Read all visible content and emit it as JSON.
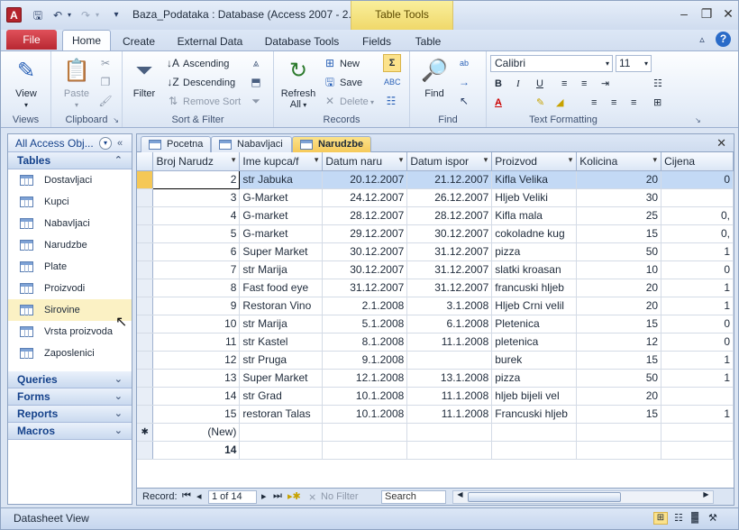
{
  "window": {
    "title": "Baza_Podataka : Database (Access 2007 - 2...",
    "context_tab": "Table Tools",
    "app_icon": "A"
  },
  "ribbon_tabs": [
    "File",
    "Home",
    "Create",
    "External Data",
    "Database Tools",
    "Fields",
    "Table"
  ],
  "ribbon": {
    "views": {
      "view_label": "View",
      "group": "Views"
    },
    "clipboard": {
      "paste_label": "Paste",
      "group": "Clipboard"
    },
    "sort_filter": {
      "filter_label": "Filter",
      "ascending": "Ascending",
      "descending": "Descending",
      "remove_sort": "Remove Sort",
      "group": "Sort & Filter"
    },
    "records": {
      "refresh_label": "Refresh",
      "refresh_all": "All",
      "new": "New",
      "save": "Save",
      "delete": "Delete",
      "group": "Records"
    },
    "find": {
      "find_label": "Find",
      "group": "Find"
    },
    "text_formatting": {
      "font": "Calibri",
      "size": "11",
      "group": "Text Formatting"
    }
  },
  "nav": {
    "header": "All Access Obj...",
    "sections": {
      "tables": "Tables",
      "queries": "Queries",
      "forms": "Forms",
      "reports": "Reports",
      "macros": "Macros"
    },
    "tables": [
      "Dostavljaci",
      "Kupci",
      "Nabavljaci",
      "Narudzbe",
      "Plate",
      "Proizvodi",
      "Sirovine",
      "Vrsta proizvoda",
      "Zaposlenici"
    ],
    "selected_index": 6
  },
  "doc_tabs": [
    "Pocetna",
    "Nabavljaci",
    "Narudzbe"
  ],
  "active_doc_tab": 2,
  "grid": {
    "columns": [
      "Broj Narudz",
      "Ime kupca/f",
      "Datum naru",
      "Datum ispor",
      "Proizvod",
      "Kolicina",
      "Cijena"
    ],
    "rows": [
      [
        "2",
        "str Jabuka",
        "20.12.2007",
        "21.12.2007",
        "Kifla Velika",
        "20",
        "0"
      ],
      [
        "3",
        "G-Market",
        "24.12.2007",
        "26.12.2007",
        "Hljeb Veliki",
        "30",
        ""
      ],
      [
        "4",
        "G-market",
        "28.12.2007",
        "28.12.2007",
        "Kifla mala",
        "25",
        "0,"
      ],
      [
        "5",
        "G-market",
        "29.12.2007",
        "30.12.2007",
        "cokoladne kug",
        "15",
        "0,"
      ],
      [
        "6",
        "Super Market",
        "30.12.2007",
        "31.12.2007",
        "pizza",
        "50",
        "1"
      ],
      [
        "7",
        "str Marija",
        "30.12.2007",
        "31.12.2007",
        "slatki kroasan",
        "10",
        "0"
      ],
      [
        "8",
        "Fast food eye",
        "31.12.2007",
        "31.12.2007",
        "francuski hljeb",
        "20",
        "1"
      ],
      [
        "9",
        "Restoran Vino",
        "2.1.2008",
        "3.1.2008",
        "Hljeb Crni velil",
        "20",
        "1"
      ],
      [
        "10",
        "str Marija",
        "5.1.2008",
        "6.1.2008",
        "Pletenica",
        "15",
        "0"
      ],
      [
        "11",
        "str Kastel",
        "8.1.2008",
        "11.1.2008",
        "pletenica",
        "12",
        "0"
      ],
      [
        "12",
        "str Pruga",
        "9.1.2008",
        "",
        "burek",
        "15",
        "1"
      ],
      [
        "13",
        "Super Market",
        "12.1.2008",
        "13.1.2008",
        "pizza",
        "50",
        "1"
      ],
      [
        "14",
        "str Grad",
        "10.1.2008",
        "11.1.2008",
        "hljeb bijeli vel",
        "20",
        ""
      ],
      [
        "15",
        "restoran Talas",
        "10.1.2008",
        "11.1.2008",
        "Francuski hljeb",
        "15",
        "1"
      ]
    ],
    "new_row_label": "(New)",
    "total_label": "14"
  },
  "record_nav": {
    "label": "Record:",
    "position": "1 of 14",
    "filter": "No Filter",
    "search": "Search"
  },
  "status": {
    "text": "Datasheet View"
  }
}
